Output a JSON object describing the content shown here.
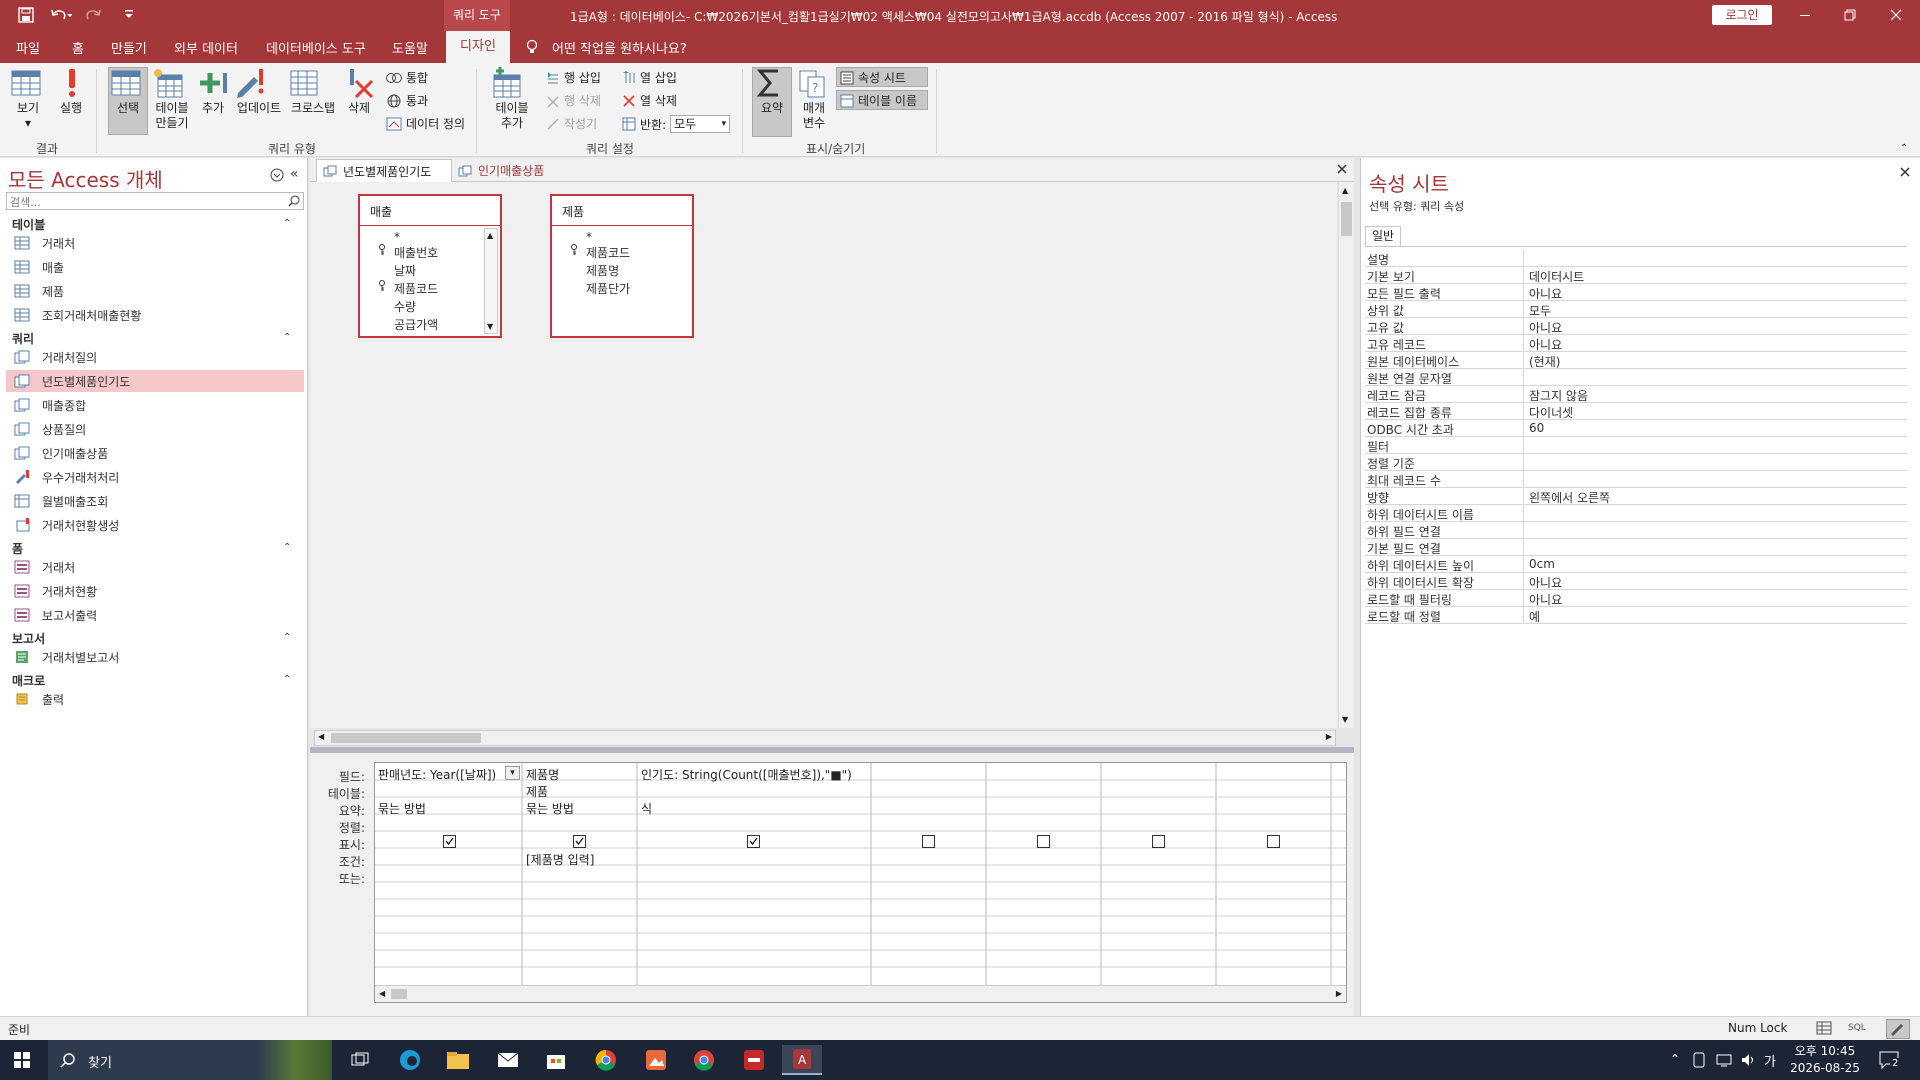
{
  "title": {
    "context_tab": "쿼리 도구",
    "window_title": "1급A형 : 데이터베이스- C:₩2026기본서_컴활1급실기₩02 액세스₩04 실전모의고사₩1급A형.accdb (Access 2007 - 2016 파일 형식)  -  Access",
    "login": "로그인"
  },
  "ribbon_tabs": [
    "파일",
    "홈",
    "만들기",
    "외부 데이터",
    "데이터베이스 도구",
    "도움말",
    "디자인"
  ],
  "tell_me": "어떤 작업을 원하시나요?",
  "ribbon": {
    "results": {
      "label": "결과",
      "view": "보기",
      "run": "실행"
    },
    "query_type": {
      "label": "쿼리 유형",
      "select": "선택",
      "make_table": "테이블\n만들기",
      "append": "추가",
      "update": "업데이트",
      "crosstab": "크로스탭",
      "delete": "삭제",
      "union": "통합",
      "pass_through": "통과",
      "data_def": "데이터 정의"
    },
    "query_setup": {
      "label": "쿼리 설정",
      "add_table": "테이블\n추가",
      "insert_row": "행 삽입",
      "delete_row": "행 삭제",
      "builder": "작성기",
      "insert_col": "열 삽입",
      "delete_col": "열 삭제",
      "return_label": "반환:",
      "return_value": "모두"
    },
    "show_hide": {
      "label": "표시/숨기기",
      "totals": "요약",
      "params": "매개\n변수",
      "prop_sheet": "속성 시트",
      "table_names": "테이블 이름"
    }
  },
  "nav": {
    "title": "모든 Access 개체",
    "search_placeholder": "검색...",
    "sections": [
      {
        "name": "테이블",
        "items": [
          "거래처",
          "매출",
          "제품",
          "조회거래처매출현황"
        ]
      },
      {
        "name": "쿼리",
        "items": [
          "거래처질의",
          "년도별제품인기도",
          "매출종합",
          "상품질의",
          "인기매출상품",
          "우수거래처처리",
          "월별매출조회",
          "거래처현황생성"
        ]
      },
      {
        "name": "폼",
        "items": [
          "거래처",
          "거래처현황",
          "보고서출력"
        ]
      },
      {
        "name": "보고서",
        "items": [
          "거래처별보고서"
        ]
      },
      {
        "name": "매크로",
        "items": [
          "출력"
        ]
      }
    ],
    "selected": "년도별제품인기도"
  },
  "doc_tabs": [
    "년도별제품인기도",
    "인기매출상품"
  ],
  "tables": [
    {
      "name": "매출",
      "fields": [
        "*",
        "매출번호",
        "날짜",
        "제품코드",
        "수량",
        "공급가액"
      ],
      "keys": [
        1,
        3
      ]
    },
    {
      "name": "제품",
      "fields": [
        "*",
        "제품코드",
        "제품명",
        "제품단가"
      ],
      "keys": [
        1
      ]
    }
  ],
  "grid": {
    "row_labels": [
      "필드:",
      "테이블:",
      "요약:",
      "정렬:",
      "표시:",
      "조건:",
      "또는:"
    ],
    "columns": [
      {
        "field": "판매년도: Year([날짜])",
        "table": "",
        "total": "묶는 방법",
        "show": true,
        "criteria": ""
      },
      {
        "field": "제품명",
        "table": "제품",
        "total": "묶는 방법",
        "show": true,
        "criteria": "[제품명 입력]"
      },
      {
        "field": "인기도: String(Count([매출번호]),\"■\")",
        "table": "",
        "total": "식",
        "show": true,
        "criteria": ""
      },
      {
        "field": "",
        "table": "",
        "total": "",
        "show": false,
        "criteria": ""
      },
      {
        "field": "",
        "table": "",
        "total": "",
        "show": false,
        "criteria": ""
      },
      {
        "field": "",
        "table": "",
        "total": "",
        "show": false,
        "criteria": ""
      },
      {
        "field": "",
        "table": "",
        "total": "",
        "show": false,
        "criteria": ""
      }
    ]
  },
  "props": {
    "title": "속성 시트",
    "sel_type": "선택 유형:  쿼리 속성",
    "tab": "일반",
    "rows": [
      [
        "설명",
        ""
      ],
      [
        "기본 보기",
        "데이터시트"
      ],
      [
        "모든 필드 출력",
        "아니요"
      ],
      [
        "상위 값",
        "모두"
      ],
      [
        "고유 값",
        "아니요"
      ],
      [
        "고유 레코드",
        "아니요"
      ],
      [
        "원본 데이터베이스",
        "(현재)"
      ],
      [
        "원본 연결 문자열",
        ""
      ],
      [
        "레코드 잠금",
        "잠그지 않음"
      ],
      [
        "레코드 집합 종류",
        "다이너셋"
      ],
      [
        "ODBC 시간 초과",
        "60"
      ],
      [
        "필터",
        ""
      ],
      [
        "정렬 기준",
        ""
      ],
      [
        "최대 레코드 수",
        ""
      ],
      [
        "방향",
        "왼쪽에서 오른쪽"
      ],
      [
        "하위 데이터시트 이름",
        ""
      ],
      [
        "하위 필드 연결",
        ""
      ],
      [
        "기본 필드 연결",
        ""
      ],
      [
        "하위 데이터시트 높이",
        "0cm"
      ],
      [
        "하위 데이터시트 확장",
        "아니요"
      ],
      [
        "로드할 때 필터링",
        "아니요"
      ],
      [
        "로드할 때 정렬",
        "예"
      ]
    ]
  },
  "status": {
    "left": "준비",
    "num_lock": "Num Lock"
  },
  "taskbar": {
    "search": "찾기",
    "time": "오후 10:45",
    "date": "2026-08-25",
    "ime": "가",
    "notif": "2"
  },
  "colors": {
    "accent": "#a4373a",
    "selected_nav": "#f6c7c9",
    "table_border": "#c2393b",
    "taskbar": "#1b2536"
  }
}
